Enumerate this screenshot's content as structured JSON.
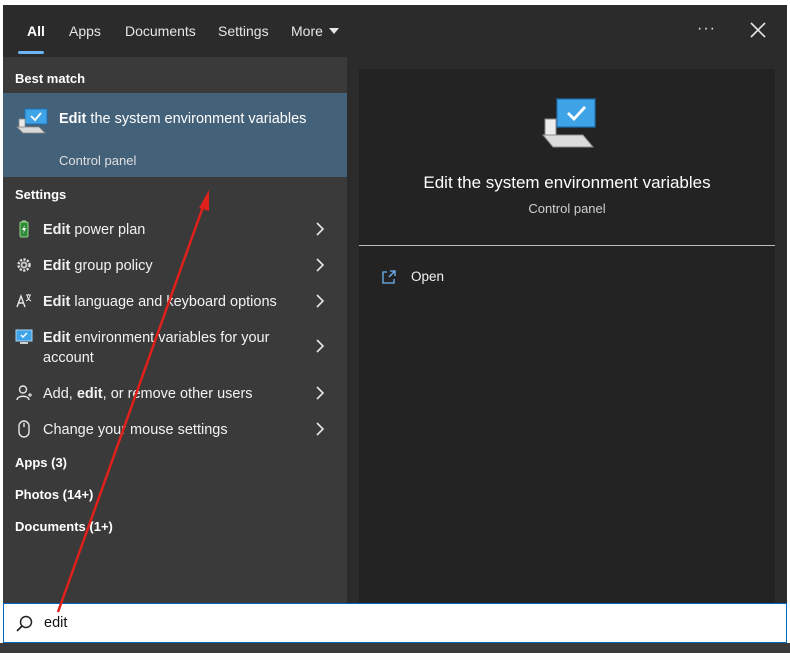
{
  "tabs": [
    {
      "label": "All",
      "active": true
    },
    {
      "label": "Apps"
    },
    {
      "label": "Documents"
    },
    {
      "label": "Settings"
    },
    {
      "label": "More"
    }
  ],
  "topbar": {
    "ellipsis": "···",
    "close_icon": "close-icon"
  },
  "best_match": {
    "section": "Best match",
    "title_bold": "Edit",
    "title_rest": " the system environment variables",
    "subtitle": "Control panel",
    "icon": "monitor-check-icon"
  },
  "settings": {
    "section": "Settings",
    "items": [
      {
        "bold": "Edit",
        "rest": " power plan",
        "icon": "battery-icon"
      },
      {
        "bold": "Edit",
        "rest": " group policy",
        "icon": "gear-icon"
      },
      {
        "bold": "Edit",
        "rest": " language and keyboard options",
        "icon": "language-icon"
      },
      {
        "bold": "Edit",
        "rest": " environment variables for your account",
        "icon": "monitor-icon"
      },
      {
        "pre": "Add, ",
        "bold": "edit",
        "rest": ", or remove other users",
        "icon": "user-icon"
      },
      {
        "pre": "",
        "bold": "",
        "rest": "Change your mouse settings",
        "icon": "mouse-icon"
      }
    ]
  },
  "collapsed_groups": [
    {
      "label": "Apps (3)"
    },
    {
      "label": "Photos (14+)"
    },
    {
      "label": "Documents (1+)"
    }
  ],
  "preview": {
    "title": "Edit the system environment variables",
    "subtitle": "Control panel",
    "action": "Open"
  },
  "search": {
    "value": "edit"
  },
  "colors": {
    "accent": "#6cb4f5",
    "selected": "#44617a",
    "annotation_arrow": "#e0201a"
  }
}
